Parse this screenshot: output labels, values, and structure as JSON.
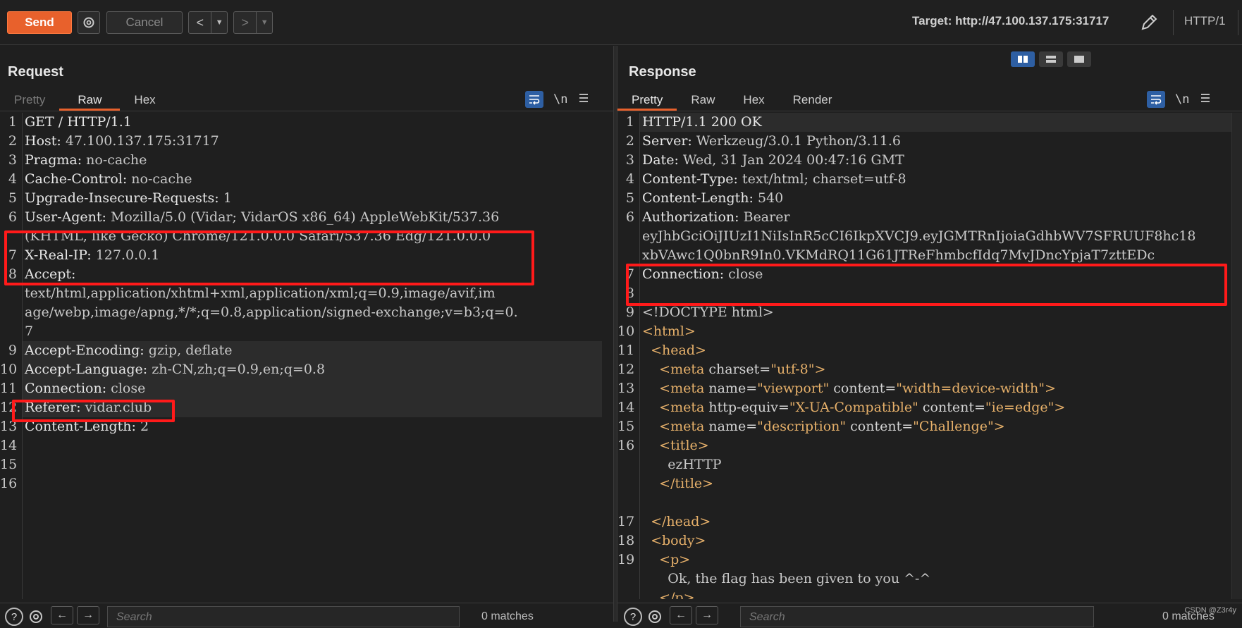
{
  "toolbar": {
    "send_label": "Send",
    "cancel_label": "Cancel",
    "back_label": "<",
    "forward_label": ">",
    "target_label": "Target: http://47.100.137.175:31717",
    "protocol_label": "HTTP/1"
  },
  "request": {
    "title": "Request",
    "tabs": [
      "Pretty",
      "Raw",
      "Hex"
    ],
    "active_tab": "Raw",
    "newline_label": "\\n",
    "lines": [
      {
        "n": "1",
        "key": "GET / HTTP/1.1",
        "val": ""
      },
      {
        "n": "2",
        "key": "Host:",
        "val": " 47.100.137.175:31717"
      },
      {
        "n": "3",
        "key": "Pragma:",
        "val": " no-cache"
      },
      {
        "n": "4",
        "key": "Cache-Control:",
        "val": " no-cache"
      },
      {
        "n": "5",
        "key": "Upgrade-Insecure-Requests:",
        "val": " 1"
      },
      {
        "n": "6",
        "key": "User-Agent:",
        "val": " Mozilla/5.0 (Vidar; VidarOS x86_64) AppleWebKit/537.36"
      },
      {
        "n": "",
        "key": "",
        "val": "(KHTML, like Gecko) Chrome/121.0.0.0 Safari/537.36 Edg/121.0.0.0"
      },
      {
        "n": "7",
        "key": "X-Real-IP:",
        "val": " 127.0.0.1"
      },
      {
        "n": "8",
        "key": "Accept:",
        "val": ""
      },
      {
        "n": "",
        "key": "",
        "val": "text/html,application/xhtml+xml,application/xml;q=0.9,image/avif,im"
      },
      {
        "n": "",
        "key": "",
        "val": "age/webp,image/apng,*/*;q=0.8,application/signed-exchange;v=b3;q=0."
      },
      {
        "n": "",
        "key": "",
        "val": "7"
      },
      {
        "n": "9",
        "key": "Accept-Encoding:",
        "val": " gzip, deflate"
      },
      {
        "n": "10",
        "key": "Accept-Language:",
        "val": " zh-CN,zh;q=0.9,en;q=0.8"
      },
      {
        "n": "11",
        "key": "Connection:",
        "val": " close"
      },
      {
        "n": "12",
        "key": "Referer:",
        "val": " vidar.club"
      },
      {
        "n": "13",
        "key": "Content-Length:",
        "val": " 2"
      },
      {
        "n": "14",
        "key": "",
        "val": ""
      },
      {
        "n": "15",
        "key": "",
        "val": ""
      },
      {
        "n": "16",
        "key": "",
        "val": ""
      }
    ],
    "search_placeholder": "Search",
    "matches_label": "0 matches"
  },
  "response": {
    "title": "Response",
    "tabs": [
      "Pretty",
      "Raw",
      "Hex",
      "Render"
    ],
    "active_tab": "Pretty",
    "newline_label": "\\n",
    "lines": [
      {
        "n": "1",
        "parts": [
          [
            "key",
            "HTTP/1.1 200 OK"
          ]
        ]
      },
      {
        "n": "2",
        "parts": [
          [
            "key",
            "Server:"
          ],
          [
            "val",
            " Werkzeug/3.0.1 Python/3.11.6"
          ]
        ]
      },
      {
        "n": "3",
        "parts": [
          [
            "key",
            "Date:"
          ],
          [
            "val",
            " Wed, 31 Jan 2024 00:47:16 GMT"
          ]
        ]
      },
      {
        "n": "4",
        "parts": [
          [
            "key",
            "Content-Type:"
          ],
          [
            "val",
            " text/html; charset=utf-8"
          ]
        ]
      },
      {
        "n": "5",
        "parts": [
          [
            "key",
            "Content-Length:"
          ],
          [
            "val",
            " 540"
          ]
        ]
      },
      {
        "n": "6",
        "parts": [
          [
            "key",
            "Authorization:"
          ],
          [
            "val",
            " Bearer"
          ]
        ]
      },
      {
        "n": "",
        "parts": [
          [
            "val",
            "eyJhbGciOiJIUzI1NiIsInR5cCI6IkpXVCJ9.eyJGMTRnIjoiaGdhbWV7SFRUUF8hc18"
          ]
        ]
      },
      {
        "n": "",
        "parts": [
          [
            "val",
            "xbVAwc1Q0bnR9In0.VKMdRQ11G61JTReFhmbcfIdq7MvJDncYpjaT7zttEDc"
          ]
        ]
      },
      {
        "n": "7",
        "parts": [
          [
            "key",
            "Connection:"
          ],
          [
            "val",
            " close"
          ]
        ]
      },
      {
        "n": "8",
        "parts": []
      },
      {
        "n": "9",
        "parts": [
          [
            "val",
            "<!DOCTYPE html>"
          ]
        ]
      },
      {
        "n": "10",
        "parts": [
          [
            "tag",
            "<html>"
          ]
        ]
      },
      {
        "n": "11",
        "parts": [
          [
            "val",
            "  "
          ],
          [
            "tag",
            "<head>"
          ]
        ]
      },
      {
        "n": "12",
        "parts": [
          [
            "val",
            "    "
          ],
          [
            "tag",
            "<meta"
          ],
          [
            "attr",
            " charset="
          ],
          [
            "str",
            "\"utf-8\""
          ],
          [
            "tag",
            ">"
          ]
        ]
      },
      {
        "n": "13",
        "parts": [
          [
            "val",
            "    "
          ],
          [
            "tag",
            "<meta"
          ],
          [
            "attr",
            " name="
          ],
          [
            "str",
            "\"viewport\""
          ],
          [
            "attr",
            " content="
          ],
          [
            "str",
            "\"width=device-width\""
          ],
          [
            "tag",
            ">"
          ]
        ]
      },
      {
        "n": "14",
        "parts": [
          [
            "val",
            "    "
          ],
          [
            "tag",
            "<meta"
          ],
          [
            "attr",
            " http-equiv="
          ],
          [
            "str",
            "\"X-UA-Compatible\""
          ],
          [
            "attr",
            " content="
          ],
          [
            "str",
            "\"ie=edge\""
          ],
          [
            "tag",
            ">"
          ]
        ]
      },
      {
        "n": "15",
        "parts": [
          [
            "val",
            "    "
          ],
          [
            "tag",
            "<meta"
          ],
          [
            "attr",
            " name="
          ],
          [
            "str",
            "\"description\""
          ],
          [
            "attr",
            " content="
          ],
          [
            "str",
            "\"Challenge\""
          ],
          [
            "tag",
            ">"
          ]
        ]
      },
      {
        "n": "16",
        "parts": [
          [
            "val",
            "    "
          ],
          [
            "tag",
            "<title>"
          ]
        ]
      },
      {
        "n": "",
        "parts": [
          [
            "val",
            "      ezHTTP"
          ]
        ]
      },
      {
        "n": "",
        "parts": [
          [
            "val",
            "    "
          ],
          [
            "tag",
            "</title>"
          ]
        ]
      },
      {
        "n": "",
        "parts": []
      },
      {
        "n": "17",
        "parts": [
          [
            "val",
            "  "
          ],
          [
            "tag",
            "</head>"
          ]
        ]
      },
      {
        "n": "18",
        "parts": [
          [
            "val",
            "  "
          ],
          [
            "tag",
            "<body>"
          ]
        ]
      },
      {
        "n": "19",
        "parts": [
          [
            "val",
            "    "
          ],
          [
            "tag",
            "<p>"
          ]
        ]
      },
      {
        "n": "",
        "parts": [
          [
            "val",
            "      Ok, the flag has been given to you ^-^"
          ]
        ]
      },
      {
        "n": "",
        "parts": [
          [
            "val",
            "    "
          ],
          [
            "tag",
            "</p>"
          ]
        ]
      }
    ],
    "search_placeholder": "Search",
    "matches_label": "0 matches"
  },
  "watermark": "CSDN @Z3r4y",
  "colors": {
    "accent": "#e8612c",
    "highlight_box": "#ff1a1a",
    "wrap_button": "#2e5fa3"
  }
}
